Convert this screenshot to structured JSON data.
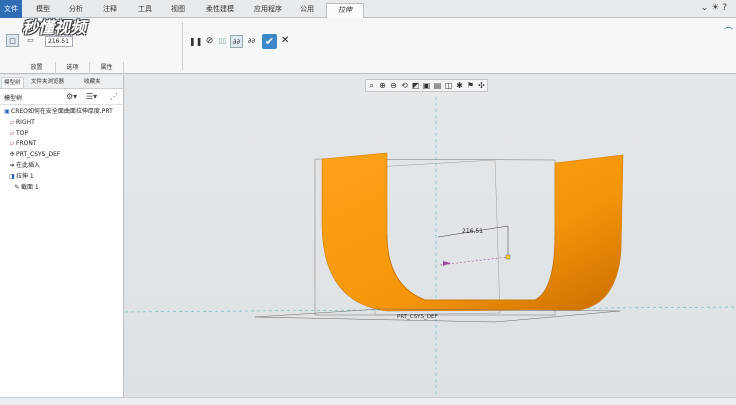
{
  "ribbon_tabs": [
    {
      "label": "文件",
      "kind": "file"
    },
    {
      "label": "模型"
    },
    {
      "label": "分析"
    },
    {
      "label": "注释"
    },
    {
      "label": "工具"
    },
    {
      "label": "视图"
    },
    {
      "label": "柔性建模"
    },
    {
      "label": "应用程序"
    },
    {
      "label": "公用"
    },
    {
      "label": "拉伸",
      "active": true
    }
  ],
  "watermark": "秒懂视频",
  "ribbon": {
    "depth_value": "216.51",
    "subtabs": [
      "放置",
      "选项",
      "属性"
    ],
    "pause_icon": "pause-icon",
    "stop_icon": "no-preview-icon",
    "confirm_icon": "check-icon",
    "cancel_icon": "close-icon"
  },
  "panel": {
    "tabs": [
      "模型树",
      "文件夹浏览器",
      "收藏夹"
    ],
    "tree_title": "模型树",
    "tree_items": [
      {
        "label": "CREO如何在安全面曲面拉伸厚度.PRT",
        "icon": "part-icon",
        "indent": 0
      },
      {
        "label": "RIGHT",
        "icon": "datum-plane-icon",
        "indent": 1
      },
      {
        "label": "TOP",
        "icon": "datum-plane-icon",
        "indent": 1
      },
      {
        "label": "FRONT",
        "icon": "datum-plane-icon",
        "indent": 1
      },
      {
        "label": "PRT_CSYS_DEF",
        "icon": "csys-icon",
        "indent": 1
      },
      {
        "label": "在此插入",
        "icon": "insert-arrow-icon",
        "indent": 1
      },
      {
        "label": "拉伸 1",
        "icon": "extrude-icon",
        "indent": 1
      },
      {
        "label": "截面 1",
        "icon": "sketch-icon",
        "indent": 2
      }
    ]
  },
  "viewport": {
    "dimension_label": "216.51",
    "csys_label": "PRT_CSYS_DEF",
    "surface_color": "#f59a0a"
  }
}
